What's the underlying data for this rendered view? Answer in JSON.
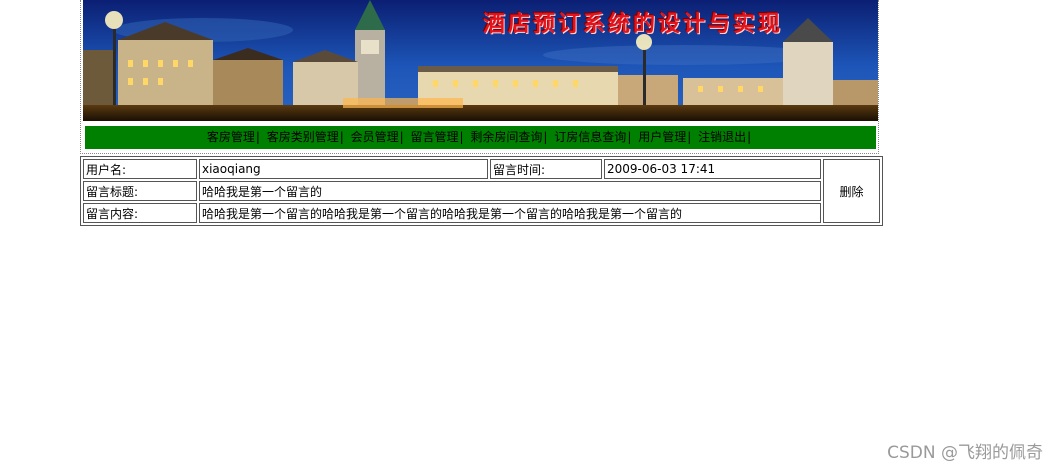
{
  "header": {
    "banner_title": "酒店预订系统的设计与实现"
  },
  "nav": {
    "items": [
      "客房管理",
      "客房类别管理",
      "会员管理",
      "留言管理",
      "剩余房间查询",
      "订房信息查询",
      "用户管理",
      "注销退出"
    ],
    "separator": "|"
  },
  "message": {
    "username_label": "用户名:",
    "username": "xiaoqiang",
    "time_label": "留言时间:",
    "time": "2009-06-03 17:41",
    "title_label": "留言标题:",
    "title": "哈哈我是第一个留言的",
    "content_label": "留言内容:",
    "content": "哈哈我是第一个留言的哈哈我是第一个留言的哈哈我是第一个留言的哈哈我是第一个留言的",
    "delete_label": "删除"
  },
  "watermark": "CSDN @飞翔的佩奇"
}
